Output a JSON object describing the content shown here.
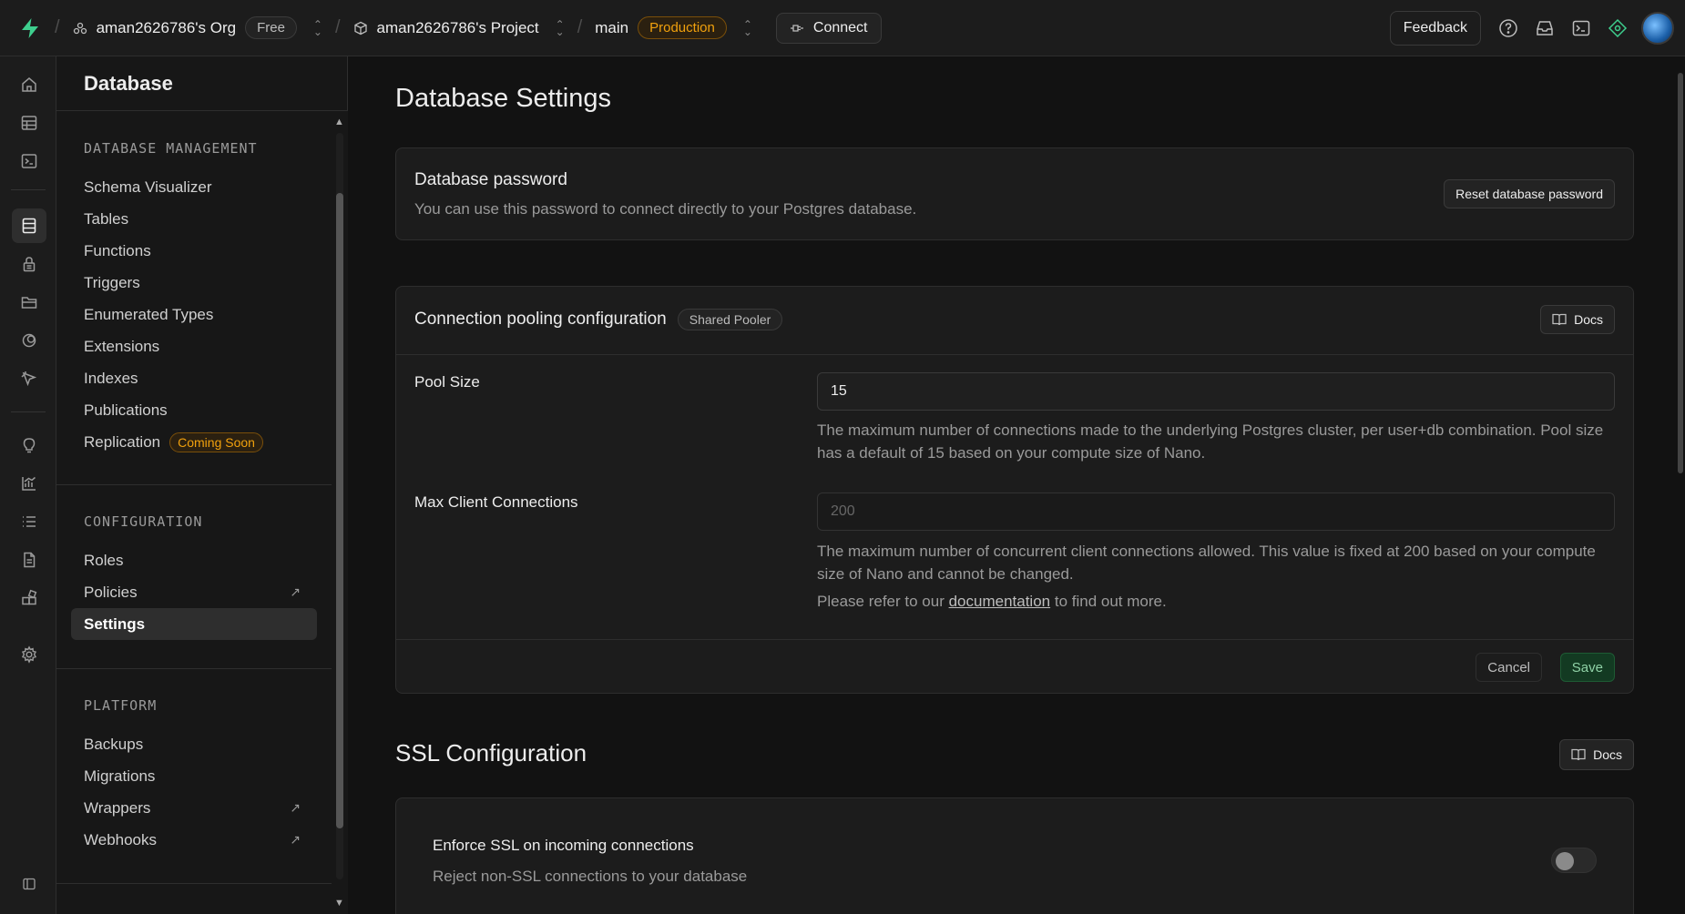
{
  "topbar": {
    "org_name": "aman2626786's Org",
    "org_plan": "Free",
    "project_name": "aman2626786's Project",
    "branch": "main",
    "environment": "Production",
    "connect_label": "Connect",
    "feedback_label": "Feedback"
  },
  "sidebar": {
    "title": "Database",
    "sections": [
      {
        "heading": "DATABASE MANAGEMENT",
        "items": [
          "Schema Visualizer",
          "Tables",
          "Functions",
          "Triggers",
          "Enumerated Types",
          "Extensions",
          "Indexes",
          "Publications",
          "Replication"
        ]
      },
      {
        "heading": "CONFIGURATION",
        "items": [
          "Roles",
          "Policies",
          "Settings"
        ]
      },
      {
        "heading": "PLATFORM",
        "items": [
          "Backups",
          "Migrations",
          "Wrappers",
          "Webhooks"
        ]
      }
    ],
    "replication_badge": "Coming Soon",
    "active_item": "Settings"
  },
  "main": {
    "page_title": "Database Settings",
    "password_card": {
      "title": "Database password",
      "description": "You can use this password to connect directly to your Postgres database.",
      "reset_label": "Reset database password"
    },
    "pooling_card": {
      "title": "Connection pooling configuration",
      "badge": "Shared Pooler",
      "docs_label": "Docs",
      "pool_size_label": "Pool Size",
      "pool_size_value": "15",
      "pool_size_help": "The maximum number of connections made to the underlying Postgres cluster, per user+db combination. Pool size has a default of 15 based on your compute size of Nano.",
      "max_client_label": "Max Client Connections",
      "max_client_placeholder": "200",
      "max_client_help": "The maximum number of concurrent client connections allowed. This value is fixed at 200 based on your compute size of Nano and cannot be changed.",
      "refer_prefix": "Please refer to our",
      "refer_link": "documentation",
      "refer_suffix": "to find out more.",
      "cancel_label": "Cancel",
      "save_label": "Save"
    },
    "ssl": {
      "title": "SSL Configuration",
      "docs_label": "Docs",
      "enforce_title": "Enforce SSL on incoming connections",
      "enforce_description": "Reject non-SSL connections to your database",
      "enforce_enabled": false
    }
  },
  "colors": {
    "accent_green": "#3ecf8e",
    "production": "#f1a10d",
    "background": "#121212",
    "surface": "#1c1c1c"
  }
}
